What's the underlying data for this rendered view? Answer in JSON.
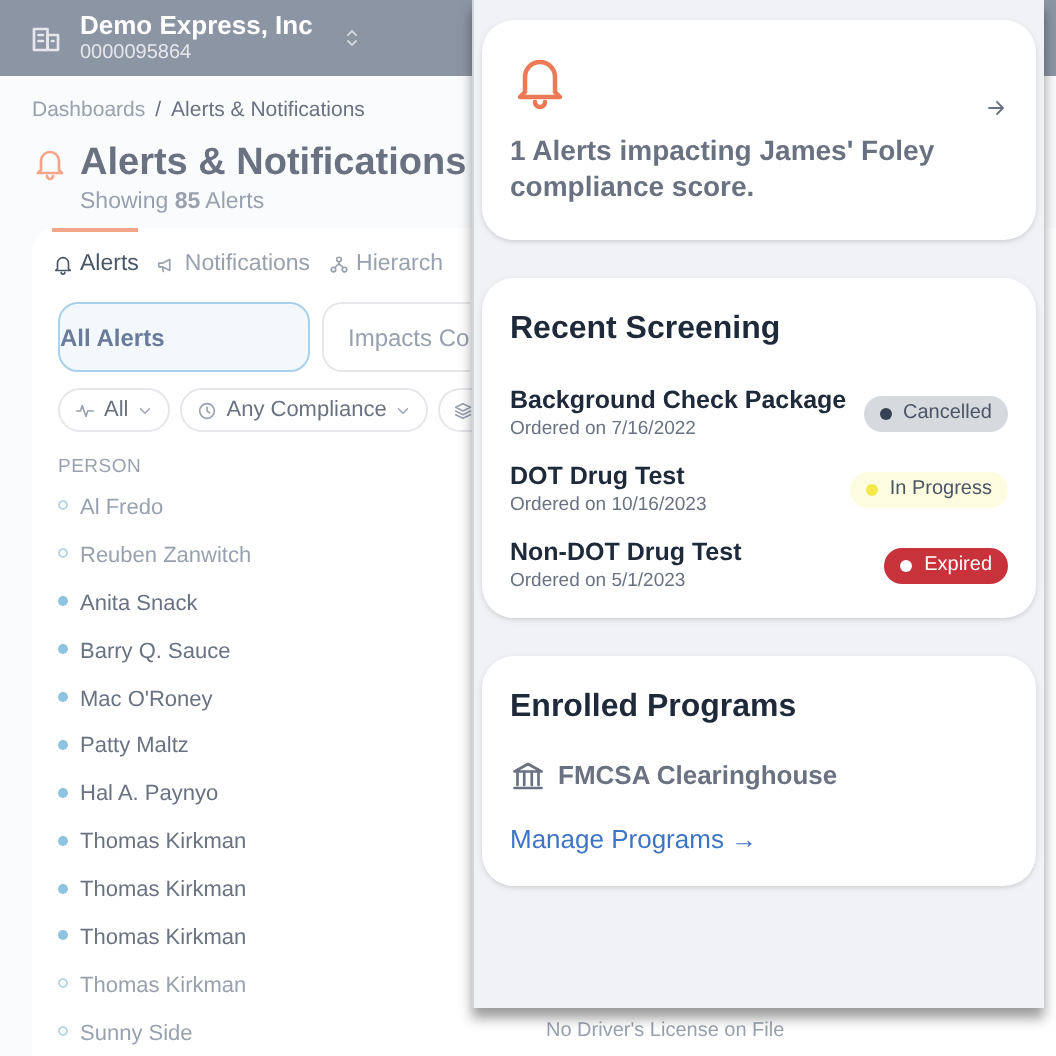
{
  "org": {
    "name": "Demo Express, Inc",
    "number": "0000095864"
  },
  "breadcrumb": {
    "items": [
      "Dashboards",
      "Alerts & Notifications"
    ],
    "separator": "/"
  },
  "page": {
    "title": "Alerts & Notifications",
    "subtitle": "Showing **85** Alerts"
  },
  "tabs": [
    {
      "label": "Alerts",
      "selected": true
    },
    {
      "label": "Notifications",
      "selected": false
    },
    {
      "label": "Hierarch",
      "selected": false
    }
  ],
  "segments": [
    {
      "label": "All Alerts",
      "selected": true
    },
    {
      "label": "Impacts Co",
      "selected": false
    }
  ],
  "filters": [
    {
      "label": "All"
    },
    {
      "label": "Any Compliance"
    }
  ],
  "table": {
    "columns": [
      "PERSON"
    ],
    "rows": [
      {
        "person": "Al Fredo",
        "active": false
      },
      {
        "person": "Reuben Zanwitch",
        "active": false
      },
      {
        "person": "Anita Snack",
        "active": true
      },
      {
        "person": "Barry Q. Sauce",
        "active": true
      },
      {
        "person": "Mac O'Roney",
        "active": true
      },
      {
        "person": "Patty Maltz",
        "active": true
      },
      {
        "person": "Hal A. Paynyo",
        "active": true
      },
      {
        "person": "Thomas Kirkman",
        "active": true
      },
      {
        "person": "Thomas Kirkman",
        "active": true
      },
      {
        "person": "Thomas Kirkman",
        "active": true
      },
      {
        "person": "Thomas Kirkman",
        "active": false
      },
      {
        "person": "Sunny Side",
        "active": false,
        "column_2": "No Driver's License on File"
      }
    ]
  },
  "panel": {
    "alert_card": {
      "text": "**1 Alerts** impacting James' Foley compliance score."
    },
    "screening": {
      "title": "Recent Screening",
      "items": [
        {
          "name": "Background Check Package",
          "date": "Ordered on 7/16/2022",
          "status": "Cancelled",
          "kind": "cancelled"
        },
        {
          "name": "DOT Drug Test",
          "date": "Ordered on 10/16/2023",
          "status": "In Progress",
          "kind": "in_progress"
        },
        {
          "name": "Non-DOT Drug Test",
          "date": "Ordered on 5/1/2023",
          "status": "Expired",
          "kind": "expired"
        }
      ]
    },
    "programs": {
      "title": "Enrolled Programs",
      "items": [
        "FMCSA Clearinghouse"
      ],
      "link": "Manage Programs →"
    }
  }
}
